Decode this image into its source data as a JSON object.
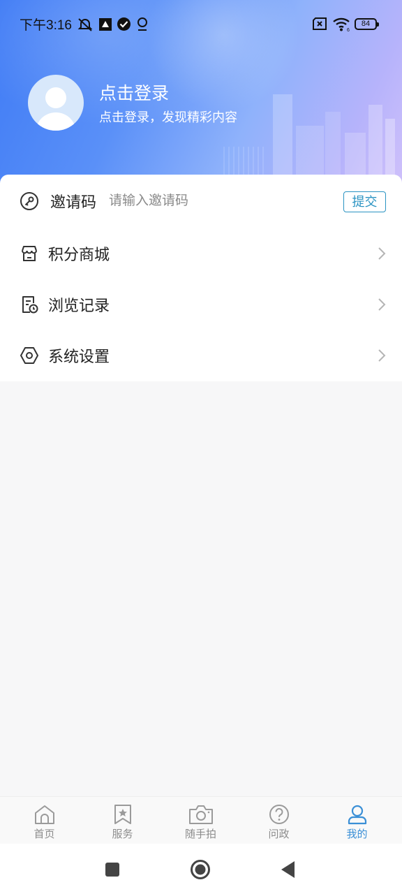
{
  "status_bar": {
    "time": "下午3:16",
    "battery": "84",
    "icons": [
      "mute-bell-icon",
      "app-notification-icon",
      "verified-icon",
      "location-icon",
      "sim-off-icon",
      "wifi-6-icon"
    ]
  },
  "profile": {
    "title": "点击登录",
    "subtitle": "点击登录，发现精彩内容"
  },
  "invite": {
    "label": "邀请码",
    "placeholder": "请输入邀请码",
    "submit_label": "提交"
  },
  "menu": {
    "items": [
      {
        "label": "积分商城",
        "icon": "store-icon"
      },
      {
        "label": "浏览记录",
        "icon": "history-icon"
      },
      {
        "label": "系统设置",
        "icon": "settings-hexagon-icon"
      }
    ]
  },
  "tabs": [
    {
      "label": "首页",
      "icon": "home-icon"
    },
    {
      "label": "服务",
      "icon": "bookmark-star-icon"
    },
    {
      "label": "随手拍",
      "icon": "camera-icon"
    },
    {
      "label": "问政",
      "icon": "question-icon"
    },
    {
      "label": "我的",
      "icon": "user-icon",
      "active": true
    }
  ],
  "colors": {
    "accent": "#2a93c2",
    "active_tab": "#3a8fd6",
    "header_start": "#3f7bf5",
    "header_end": "#cfc0fb"
  }
}
